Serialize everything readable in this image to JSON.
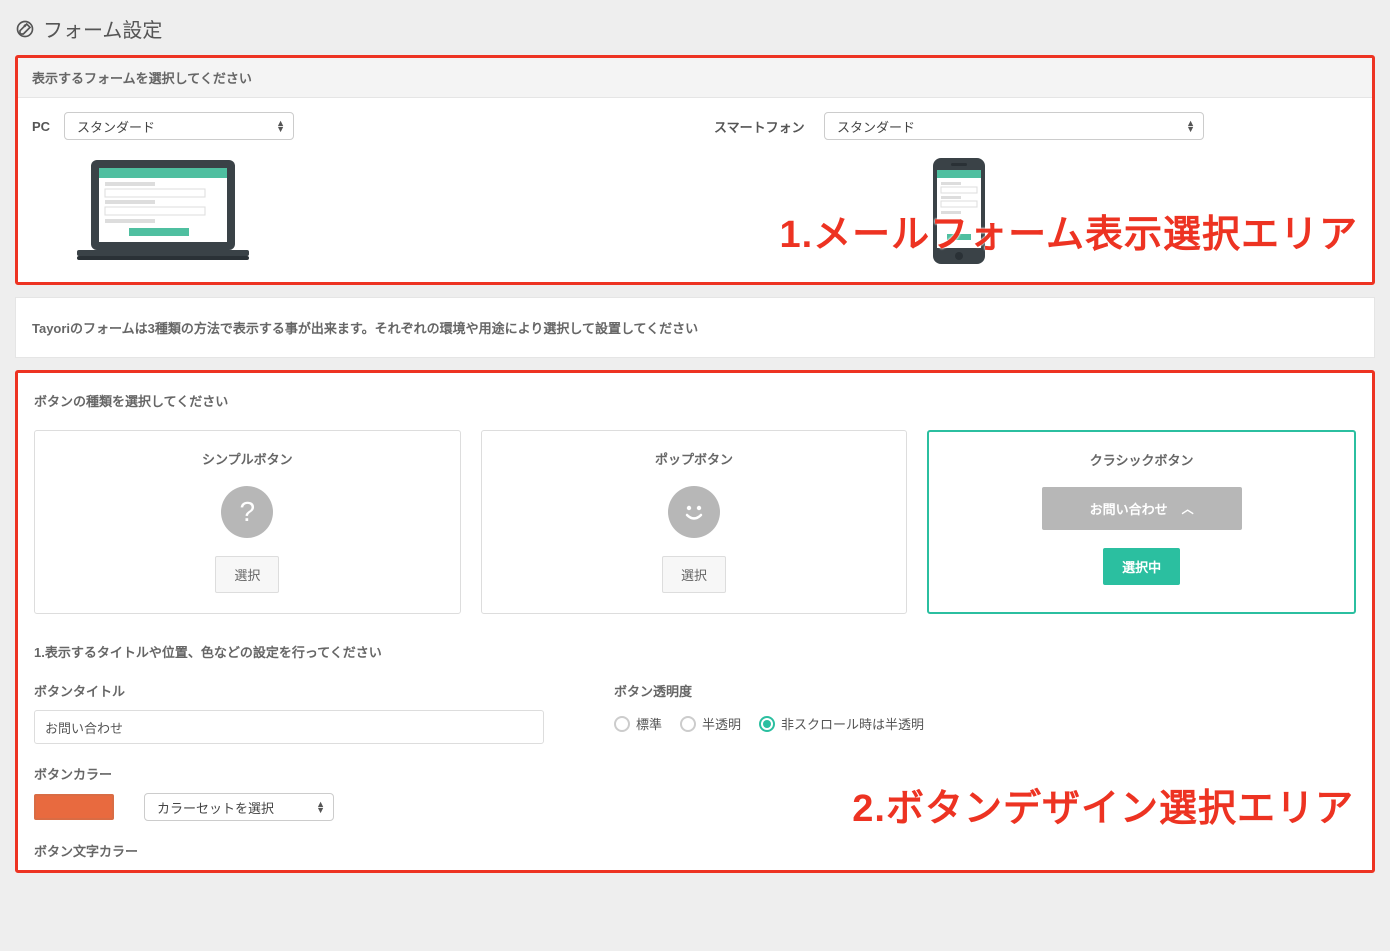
{
  "page": {
    "title": "フォーム設定"
  },
  "section1": {
    "header": "表示するフォームを選択してください",
    "pc_label": "PC",
    "pc_select": "スタンダード",
    "sm_label": "スマートフォン",
    "sm_select": "スタンダード",
    "annotation": "1.メールフォーム表示選択エリア"
  },
  "info": {
    "text": "Tayoriのフォームは3種類の方法で表示する事が出来ます。それぞれの環境や用途により選択して設置してください"
  },
  "section2": {
    "header": "ボタンの種類を選択してください",
    "cards": [
      {
        "title": "シンプルボタン",
        "btn": "選択",
        "selected": false
      },
      {
        "title": "ポップボタン",
        "btn": "選択",
        "selected": false
      },
      {
        "title": "クラシックボタン",
        "btn": "選択中",
        "selected": true,
        "preview_text": "お問い合わせ"
      }
    ],
    "settings_title": "1.表示するタイトルや位置、色などの設定を行ってください",
    "btn_title_label": "ボタンタイトル",
    "btn_title_value": "お問い合わせ",
    "btn_color_label": "ボタンカラー",
    "btn_color_hex": "#e86a3f",
    "color_set_select": "カラーセットを選択",
    "btn_text_color_label": "ボタン文字カラー",
    "opacity_label": "ボタン透明度",
    "opacity_options": [
      {
        "label": "標準",
        "checked": false
      },
      {
        "label": "半透明",
        "checked": false
      },
      {
        "label": "非スクロール時は半透明",
        "checked": true
      }
    ],
    "annotation": "2.ボタンデザイン選択エリア"
  }
}
